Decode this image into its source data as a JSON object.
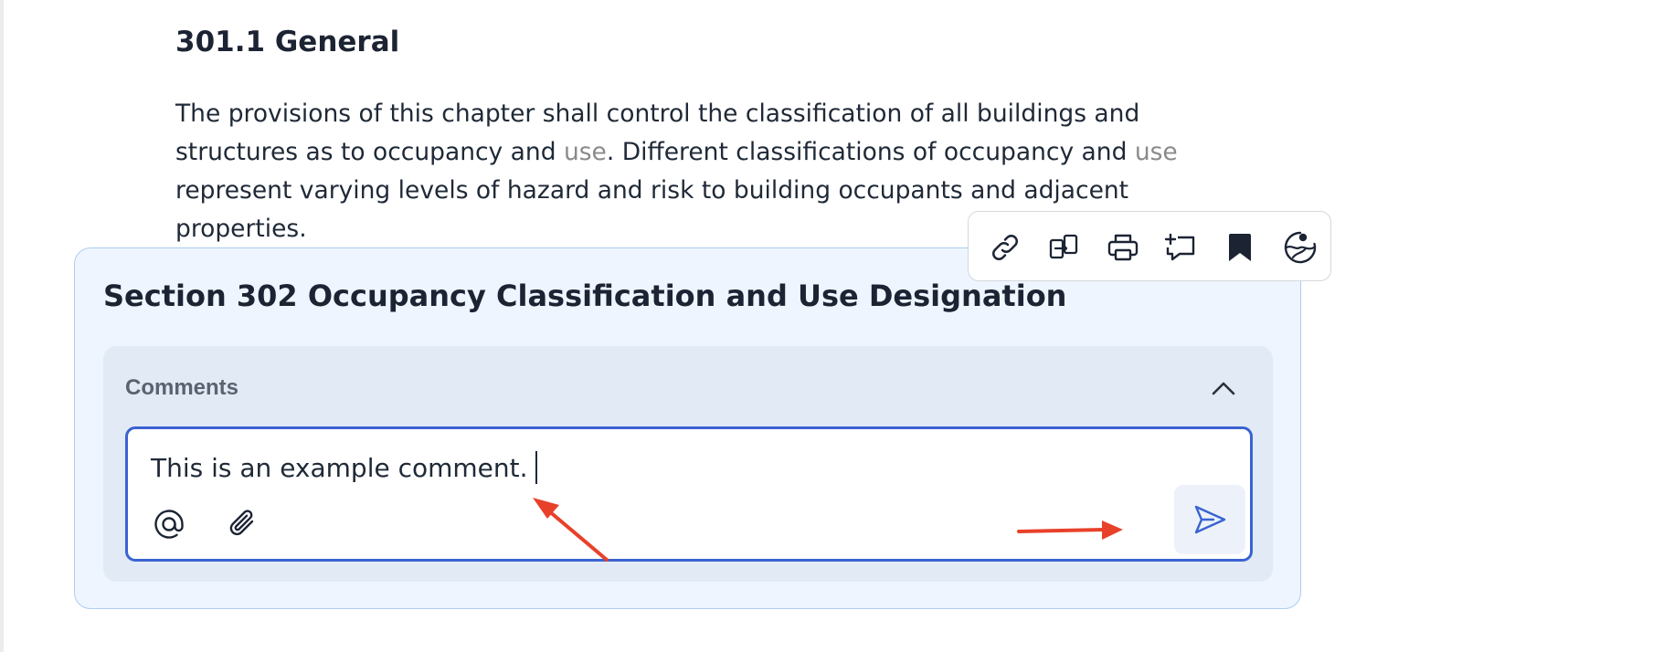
{
  "document": {
    "heading": "301.1 General",
    "paragraph": {
      "part1": "The provisions of this chapter shall control the classification of all buildings and structures as to occupancy and ",
      "term1": "use",
      "part2": ". Different classifications of occupancy and ",
      "term2": "use",
      "part3": " represent varying levels of hazard and risk to building occupants and adjacent properties."
    }
  },
  "toolbar": {
    "items": [
      {
        "icon": "link-icon"
      },
      {
        "icon": "compare-icon"
      },
      {
        "icon": "print-icon"
      },
      {
        "icon": "comment-add-icon"
      },
      {
        "icon": "bookmark-icon"
      },
      {
        "icon": "ai-globe-icon"
      }
    ]
  },
  "section": {
    "title": "Section 302 Occupancy Classification and Use Designation",
    "comments": {
      "label": "Comments",
      "input_value": "This is an example comment.",
      "buttons": {
        "mention": "at-sign-icon",
        "attach": "paperclip-icon",
        "send": "send-icon",
        "collapse": "chevron-up-icon"
      }
    }
  },
  "colors": {
    "accent": "#3a63d1",
    "card_bg": "#eef5fe",
    "annotation": "#e8412a"
  }
}
